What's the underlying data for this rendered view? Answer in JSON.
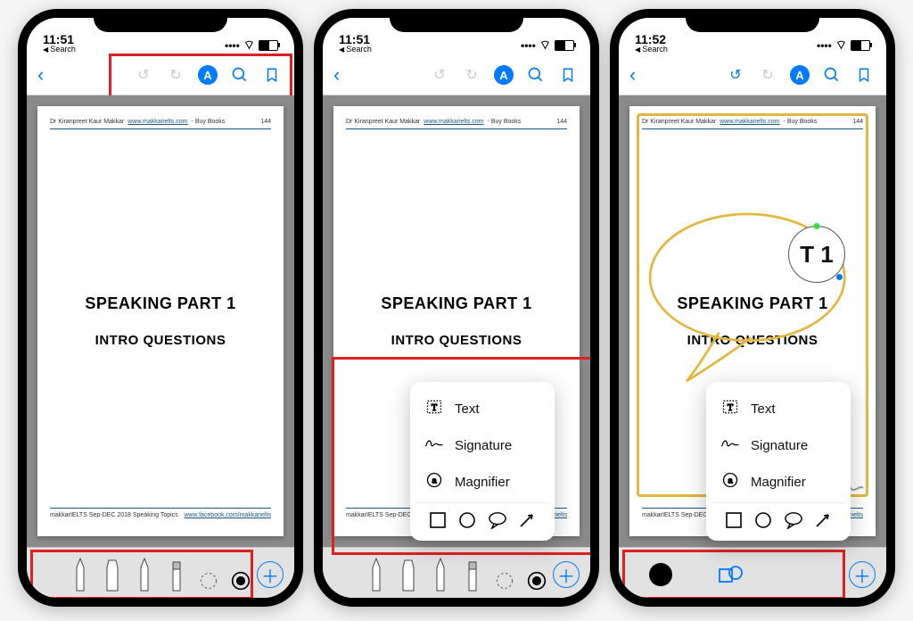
{
  "status": {
    "time1": "11:51",
    "time2": "11:51",
    "time3": "11:52",
    "back_label": "Search"
  },
  "doc": {
    "author": "Dr Kiranpreet Kaur Makkar",
    "site": "www.makkarielts.com",
    "after_site": " - Buy Books",
    "page_no": "144",
    "title": "SPEAKING PART 1",
    "subtitle": "INTRO QUESTIONS",
    "footer_left": "makkarIELTS Sep-DEC 2018 Speaking Topics",
    "footer_link": "www.facebook.com/makkarielts"
  },
  "popup": {
    "text": "Text",
    "signature": "Signature",
    "magnifier": "Magnifier"
  },
  "magnifier_sample": "T 1"
}
